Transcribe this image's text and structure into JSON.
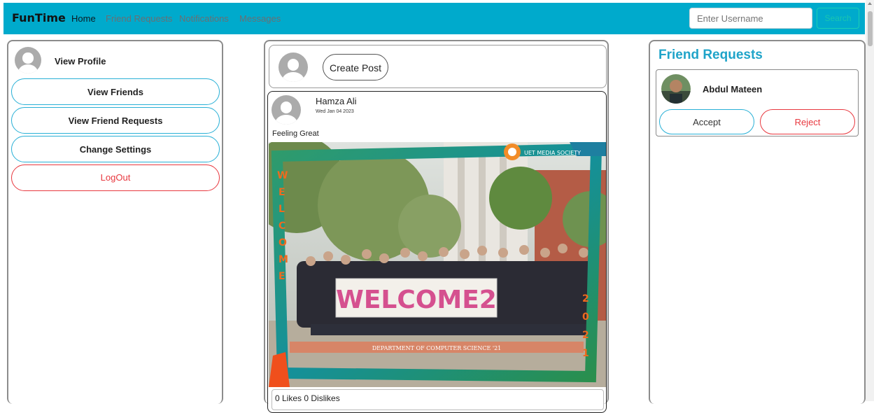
{
  "navbar": {
    "brand": "FunTime",
    "links": [
      "Home",
      "Friend Requests",
      "Notifications",
      "Messages"
    ],
    "search_placeholder": "Enter Username",
    "search_label": "Search",
    "color": "#00aacc"
  },
  "left_sidebar": {
    "profile_label": "View Profile",
    "buttons": [
      "View Friends",
      "View Friend Requests",
      "Change Settings"
    ],
    "logout_label": "LogOut"
  },
  "feed": {
    "create_post_label": "Create Post",
    "post": {
      "author": "Hamza Ali",
      "date": "Wed Jan 04 2023",
      "text": "Feeling Great",
      "image": {
        "badge": "UET MEDIA SOCIETY",
        "banner": "WELCOME2",
        "side_text": "WELCOME",
        "year": "2021",
        "footer": "DEPARTMENT OF COMPUTER SCIENCE '21"
      },
      "reactions": "0 Likes  0 Dislikes"
    }
  },
  "friend_requests": {
    "title": "Friend Requests",
    "items": [
      {
        "name": "Abdul Mateen",
        "accept_label": "Accept",
        "reject_label": "Reject"
      }
    ]
  }
}
